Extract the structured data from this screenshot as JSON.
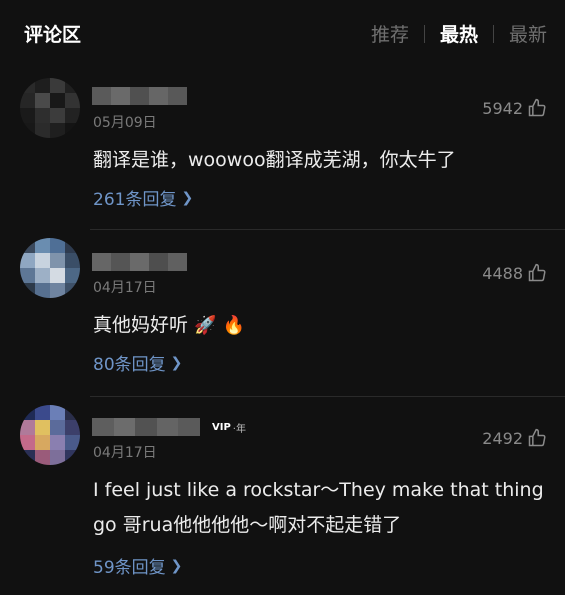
{
  "header": {
    "title": "评论区",
    "sort_options": [
      {
        "label": "推荐",
        "active": false
      },
      {
        "label": "最热",
        "active": true
      },
      {
        "label": "最新",
        "active": false
      }
    ]
  },
  "comments": [
    {
      "date": "05月09日",
      "likes": "5942",
      "text": "翻译是谁，woowoo翻译成芜湖，你太牛了",
      "replies": "261条回复",
      "avatar_colors": [
        "#2a2a2a",
        "#1e1e1e",
        "#3a3a3a",
        "#202020",
        "#262626",
        "#4a4a4a",
        "#181818",
        "#333333",
        "#1a1a1a",
        "#2e2e2e",
        "#3c3c3c",
        "#222222",
        "#181818",
        "#2b2b2b",
        "#1f1f1f",
        "#141414"
      ]
    },
    {
      "date": "04月17日",
      "likes": "4488",
      "text_before": "真他妈好听",
      "emojis": [
        "🚀",
        "🔥"
      ],
      "replies": "80条回复",
      "avatar_colors": [
        "#3b4a5e",
        "#6a8db0",
        "#4f6f96",
        "#2e3b4f",
        "#8fa7c2",
        "#c8d3df",
        "#7f93ab",
        "#3a4e67",
        "#5e7796",
        "#9db0c6",
        "#d4dbe3",
        "#4d6886",
        "#2d3a4a",
        "#577090",
        "#6f84a0",
        "#3e5169"
      ]
    },
    {
      "date": "04月17日",
      "likes": "2492",
      "badge": {
        "label": "VIP",
        "suffix": "·年"
      },
      "text": "I feel just like a rockstar～They make that thing go 哥rua他他他他～啊对不起走错了",
      "replies": "59条回复",
      "avatar_colors": [
        "#1f2a55",
        "#3b4a8c",
        "#6b7fb7",
        "#2a2e4a",
        "#b07a9a",
        "#e0c060",
        "#5b6b9b",
        "#3c3f6a",
        "#c46a8a",
        "#d7a860",
        "#8a7fb0",
        "#4a5a8a",
        "#2a2f55",
        "#9a5b7a",
        "#7d6f9a",
        "#30365e"
      ]
    }
  ],
  "colors": {
    "background": "#111111",
    "reply_link": "#6f95c8",
    "meta": "#7a7a7a"
  }
}
